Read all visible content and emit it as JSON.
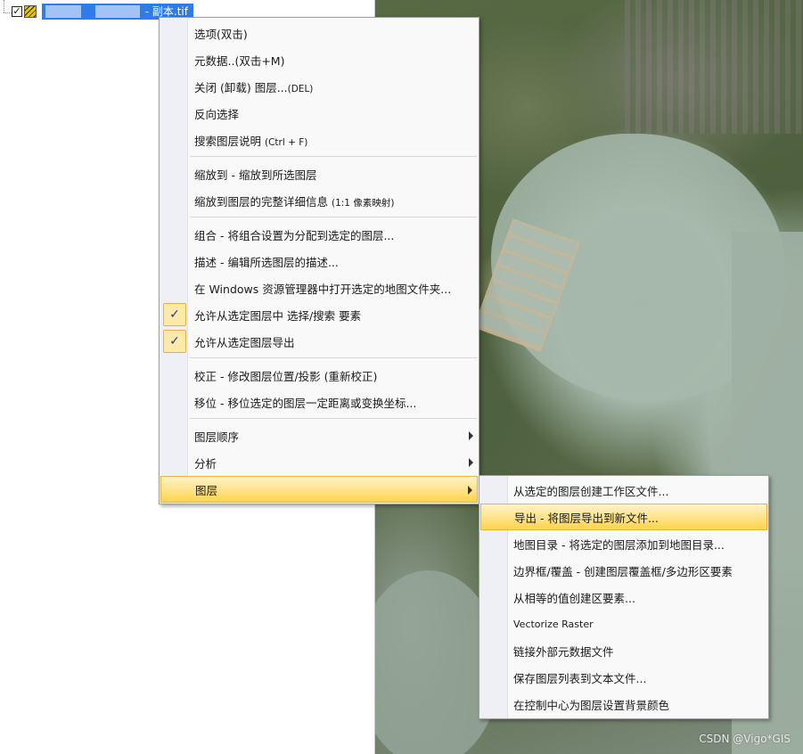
{
  "layer_tree": {
    "layer_name_suffix": "- 副本.tif",
    "checkbox_checked": "✓"
  },
  "context_menu": {
    "items": [
      {
        "label": "选项(双击)"
      },
      {
        "label": "元数据..(双击+M)"
      },
      {
        "label": "关闭 (卸载) 图层...",
        "shortcut": "(DEL)"
      },
      {
        "label": "反向选择"
      },
      {
        "label": "搜索图层说明 ",
        "shortcut": "(Ctrl + F)"
      },
      {
        "label": "缩放到 - 缩放到所选图层"
      },
      {
        "label": "缩放到图层的完整详细信息 ",
        "shortcut": "(1:1 像素映射)"
      },
      {
        "label": "组合 - 将组合设置为分配到选定的图层..."
      },
      {
        "label": "描述 - 编辑所选图层的描述..."
      },
      {
        "label": "在 Windows 资源管理器中打开选定的地图文件夹..."
      },
      {
        "label": "允许从选定图层中 选择/搜索 要素",
        "checked": "✓"
      },
      {
        "label": "允许从选定图层导出",
        "checked": "✓"
      },
      {
        "label": "校正 - 修改图层位置/投影 (重新校正)"
      },
      {
        "label": "移位 - 移位选定的图层一定距离或变换坐标..."
      },
      {
        "label": "图层顺序"
      },
      {
        "label": "分析"
      },
      {
        "label": "图层"
      }
    ]
  },
  "sub_menu": {
    "items": [
      {
        "label": "从选定的图层创建工作区文件..."
      },
      {
        "label": "导出 - 将图层导出到新文件..."
      },
      {
        "label": "地图目录 - 将选定的图层添加到地图目录..."
      },
      {
        "label": "边界框/覆盖 - 创建图层覆盖框/多边形区要素"
      },
      {
        "label": "从相等的值创建区要素..."
      },
      {
        "label": "Vectorize Raster"
      },
      {
        "label": "链接外部元数据文件"
      },
      {
        "label": "保存图层列表到文本文件..."
      },
      {
        "label": "在控制中心为图层设置背景颜色"
      }
    ]
  },
  "watermark": "CSDN @Vigo*GIS",
  "colors": {
    "selection_blue": "#2f7be8",
    "menu_highlight": "#ffd44a",
    "menu_background": "#f9f9f9"
  }
}
